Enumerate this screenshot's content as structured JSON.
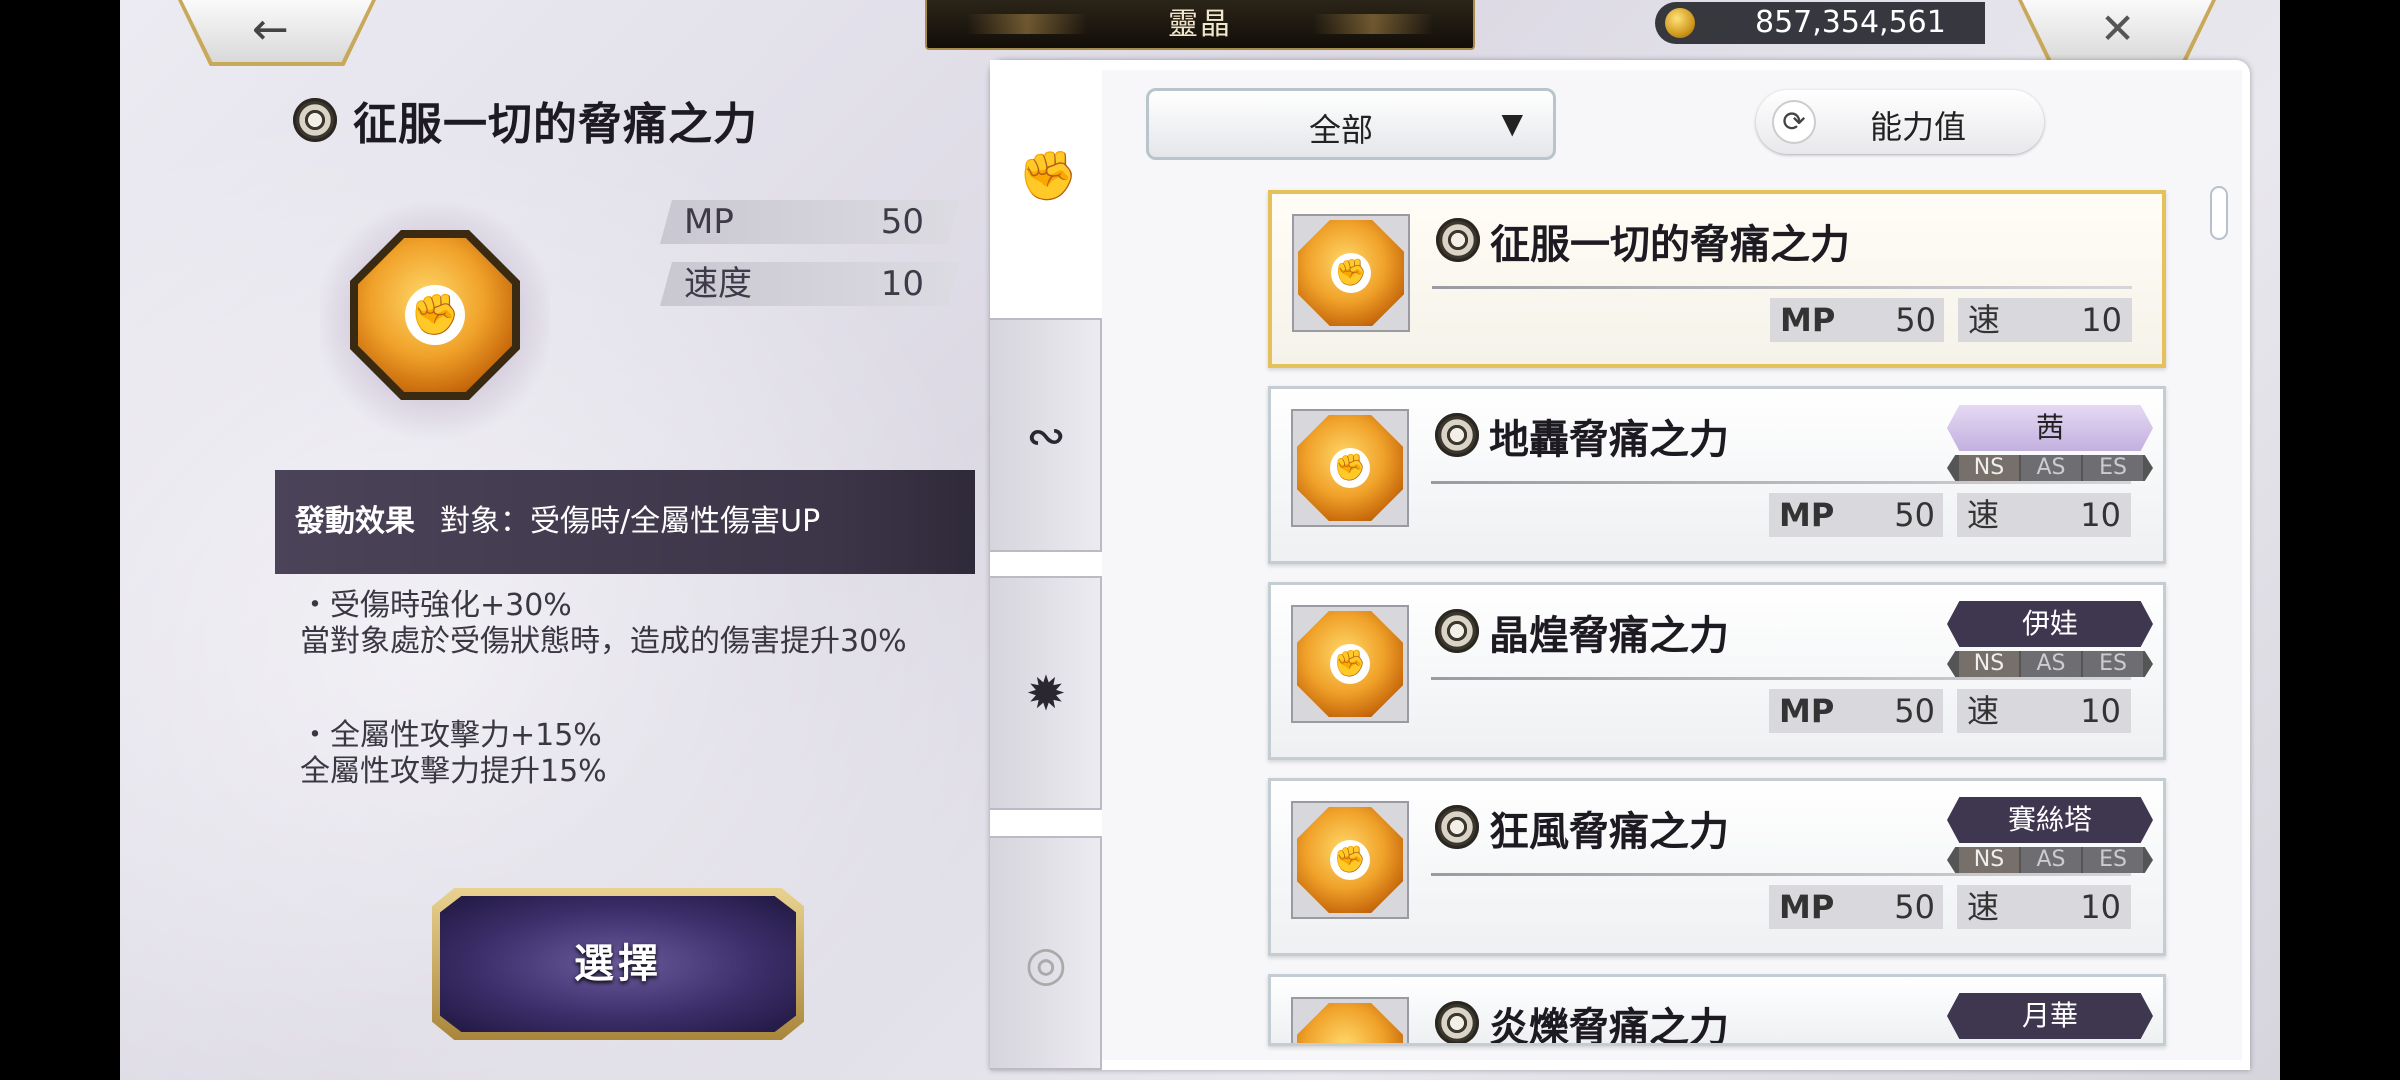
{
  "header": {
    "title": "靈晶",
    "coins": "857,354,561",
    "back_icon": "←",
    "close_icon": "✕"
  },
  "detail": {
    "title": "征服一切的脅痛之力",
    "stats": [
      {
        "label": "MP",
        "value": "50"
      },
      {
        "label": "速度",
        "value": "10"
      }
    ],
    "effect_head": "發動效果",
    "effect_text": "對象：受傷時/全屬性傷害UP",
    "effects": [
      {
        "title": "・受傷時強化+30%",
        "body": "當對象處於受傷狀態時，造成的傷害提升30%"
      },
      {
        "title": "・全屬性攻擊力+15%",
        "body": "全屬性攻擊力提升15%"
      }
    ],
    "select_label": "選擇"
  },
  "filter": {
    "dropdown_value": "全部",
    "sort_label": "能力值"
  },
  "tabs": [
    {
      "name": "fist",
      "icon": "✊"
    },
    {
      "name": "swirl",
      "icon": "∾"
    },
    {
      "name": "star",
      "icon": "✹"
    },
    {
      "name": "spiral",
      "icon": "◎"
    }
  ],
  "cards": [
    {
      "name": "征服一切的脅痛之力",
      "mp_label": "MP",
      "mp": "50",
      "spd_label": "速",
      "spd": "10",
      "character": "",
      "styles": []
    },
    {
      "name": "地轟脅痛之力",
      "mp_label": "MP",
      "mp": "50",
      "spd_label": "速",
      "spd": "10",
      "character": "茜",
      "styles": [
        "NS",
        "AS",
        "ES"
      ]
    },
    {
      "name": "晶煌脅痛之力",
      "mp_label": "MP",
      "mp": "50",
      "spd_label": "速",
      "spd": "10",
      "character": "伊娃",
      "styles": [
        "NS",
        "AS",
        "ES"
      ]
    },
    {
      "name": "狂風脅痛之力",
      "mp_label": "MP",
      "mp": "50",
      "spd_label": "速",
      "spd": "10",
      "character": "賽絲塔",
      "styles": [
        "NS",
        "AS",
        "ES"
      ]
    },
    {
      "name": "炎爍脅痛之力",
      "mp_label": "",
      "mp": "",
      "spd_label": "",
      "spd": "",
      "character": "月華",
      "styles": []
    }
  ],
  "colors": {
    "accent_gold": "#e4c15a",
    "panel_purple": "#3c3548"
  }
}
